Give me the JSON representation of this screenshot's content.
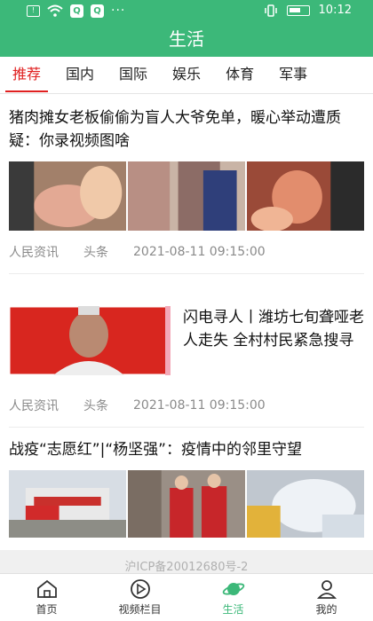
{
  "status_bar": {
    "time": "10:12",
    "icons": [
      "sim-icon",
      "wifi-icon",
      "q-icon",
      "q-icon",
      "more-icon",
      "vibrate-icon",
      "battery-icon"
    ]
  },
  "header": {
    "title": "生活"
  },
  "tabs": [
    {
      "label": "推荐",
      "active": true
    },
    {
      "label": "国内"
    },
    {
      "label": "国际"
    },
    {
      "label": "娱乐"
    },
    {
      "label": "体育"
    },
    {
      "label": "军事"
    }
  ],
  "articles": [
    {
      "title": "猪肉摊女老板偷偷为盲人大爷免单，暖心举动遭质疑：你录视频图啥",
      "source": "人民资讯",
      "tag": "头条",
      "date": "2021-08-11 09:15:00"
    },
    {
      "title": "闪电寻人丨潍坊七旬聋哑老人走失 全村村民紧急搜寻",
      "source": "人民资讯",
      "tag": "头条",
      "date": "2021-08-11 09:15:00"
    },
    {
      "title": "战疫“志愿红”|“杨坚强”：疫情中的邻里守望"
    }
  ],
  "footer": {
    "icp": "沪ICP备20012680号-2"
  },
  "bottom_nav": [
    {
      "label": "首页"
    },
    {
      "label": "视频栏目"
    },
    {
      "label": "生活",
      "active": true
    },
    {
      "label": "我的"
    }
  ],
  "colors": {
    "brand": "#3cb879",
    "tab_active": "#e02020",
    "meta": "#8a8a8a"
  }
}
